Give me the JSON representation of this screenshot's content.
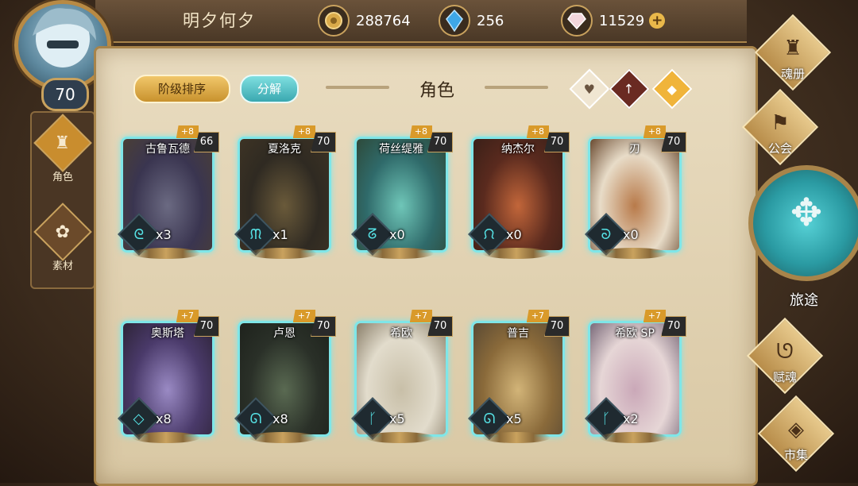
{
  "player": {
    "name": "明夕何夕",
    "level": "70"
  },
  "resources": {
    "gold": "288764",
    "crystal": "256",
    "gem": "11529"
  },
  "left_tabs": [
    {
      "label": "角色",
      "icon": "helmet-icon"
    },
    {
      "label": "素材",
      "icon": "owl-icon"
    }
  ],
  "panel": {
    "title": "角色",
    "sort_label": "阶级排序",
    "decompose_label": "分解"
  },
  "filters": [
    "heart-icon",
    "sword-icon",
    "shield-icon"
  ],
  "cards": [
    {
      "name": "古鲁瓦德",
      "level": "66",
      "bonus": "+8",
      "count": "x3",
      "art": [
        "#3a3550",
        "#6b6a82",
        "#4a3f36"
      ]
    },
    {
      "name": "夏洛克",
      "level": "70",
      "bonus": "+8",
      "count": "x1",
      "art": [
        "#2f2a22",
        "#6a5a3a",
        "#3d3324"
      ]
    },
    {
      "name": "荷丝缇雅",
      "level": "70",
      "bonus": "+8",
      "count": "x0",
      "art": [
        "#2f6a6a",
        "#6fc6b8",
        "#2e4a3a"
      ]
    },
    {
      "name": "纳杰尔",
      "level": "70",
      "bonus": "+8",
      "count": "x0",
      "art": [
        "#5a2a1e",
        "#c2663a",
        "#3a2018"
      ]
    },
    {
      "name": "刃",
      "level": "70",
      "bonus": "+8",
      "count": "x0",
      "art": [
        "#e8dcc8",
        "#b87a4a",
        "#6a4a30"
      ]
    },
    {
      "name": "奥斯塔",
      "level": "70",
      "bonus": "+7",
      "count": "x8",
      "art": [
        "#4a3a6a",
        "#9a8ac4",
        "#2e2438"
      ]
    },
    {
      "name": "卢恩",
      "level": "70",
      "bonus": "+7",
      "count": "x8",
      "art": [
        "#2a3028",
        "#5a6a52",
        "#1e221c"
      ]
    },
    {
      "name": "希欧",
      "level": "70",
      "bonus": "+7",
      "count": "x5",
      "art": [
        "#e2dccc",
        "#c8bfa8",
        "#8a7f6a"
      ]
    },
    {
      "name": "普吉",
      "level": "70",
      "bonus": "+7",
      "count": "x5",
      "art": [
        "#8a6a3a",
        "#d2b478",
        "#5a4a34"
      ]
    },
    {
      "name": "希欧 SP",
      "level": "70",
      "bonus": "+7",
      "count": "x2",
      "art": [
        "#e6d6d6",
        "#caa8b8",
        "#7a6a7a"
      ]
    }
  ],
  "right_nav": [
    {
      "label": "魂册",
      "icon": "helmet-icon"
    },
    {
      "label": "公会",
      "icon": "guild-icon"
    },
    {
      "label": "旅途",
      "icon": "compass-icon"
    },
    {
      "label": "赋魂",
      "icon": "swirl-icon"
    },
    {
      "label": "市集",
      "icon": "gem-icon"
    }
  ],
  "colors": {
    "parchment": "#e3d4b4",
    "card_border": "#7fe6e8",
    "gold": "#c9a25e",
    "soul": "#56e3e6"
  }
}
